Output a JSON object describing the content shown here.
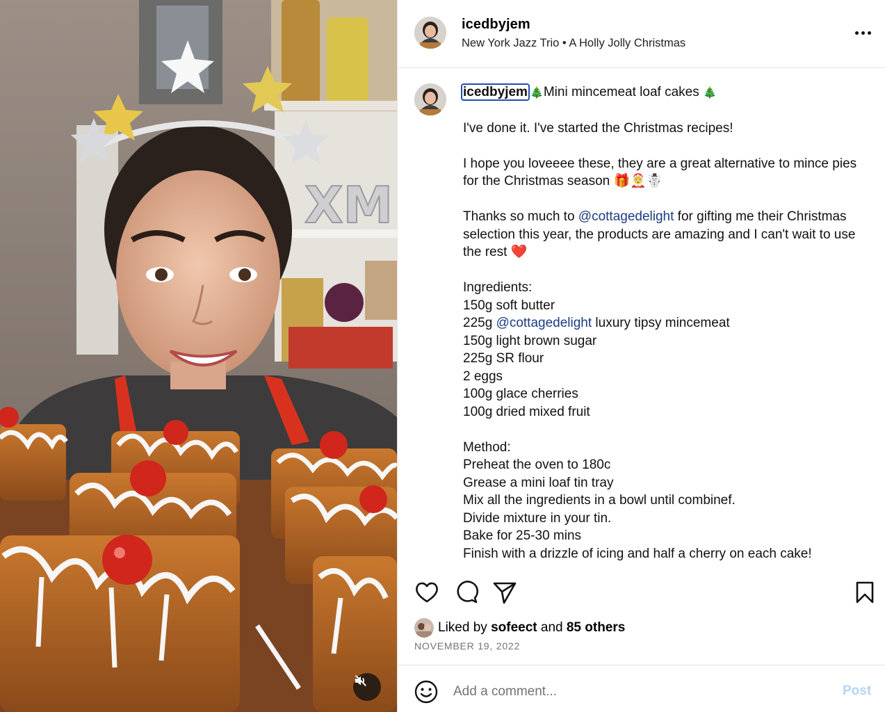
{
  "media": {
    "type": "video",
    "mute_icon": "speaker-muted-icon"
  },
  "header": {
    "username": "icedbyjem",
    "audio": "New York Jazz Trio • A Holly Jolly Christmas",
    "more_icon": "more-options-icon"
  },
  "caption": {
    "username": "icedbyjem",
    "title": "Mini mincemeat loaf cakes",
    "title_emoji": "🎄",
    "para1": "I've done it. I've started the Christmas recipes!",
    "para2": "I hope you loveeee these, they are a great alternative to mince pies for the Christmas season 🎁🤶☃️",
    "para3_pre": "Thanks so much to ",
    "para3_mention": "@cottagedelight",
    "para3_post": " for gifting me their Christmas selection this year, the products are amazing and I can't wait to use the rest ❤️",
    "ingredients_heading": "Ingredients:",
    "ingredient_1": "150g soft butter",
    "ingredient_2_pre": "225g ",
    "ingredient_2_mention": "@cottagedelight",
    "ingredient_2_post": " luxury tipsy mincemeat",
    "ingredient_3": "150g light brown sugar",
    "ingredient_4": "225g SR flour",
    "ingredient_5": "2 eggs",
    "ingredient_6": "100g glace cherries",
    "ingredient_7": "100g dried mixed fruit",
    "method_heading": "Method:",
    "method_steps": [
      "Preheat the oven to 180c",
      "Grease a mini loaf tin tray",
      "Mix all the ingredients in a bowl until combinef.",
      "Divide mixture in your tin.",
      "Bake for 25-30 mins",
      "Finish with a drizzle of icing and half a cherry on each cake!"
    ]
  },
  "actions": {
    "like_icon": "heart-icon",
    "comment_icon": "comment-bubble-icon",
    "share_icon": "paper-plane-icon",
    "save_icon": "bookmark-icon"
  },
  "likes": {
    "prefix": "Liked by ",
    "user": "sofeect",
    "middle": " and ",
    "others": "85 others"
  },
  "date": "NOVEMBER 19, 2022",
  "comment": {
    "placeholder": "Add a comment...",
    "post_label": "Post",
    "post_color": "#b3d4f7",
    "emoji_icon": "smiley-icon"
  },
  "colors": {
    "mention": "#1b3b82",
    "date_text": "#737373",
    "focus_outline": "#1f4fb5"
  }
}
